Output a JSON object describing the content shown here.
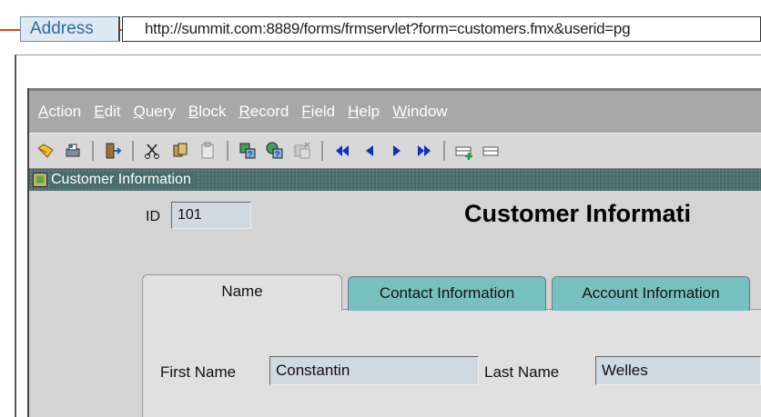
{
  "address_bar": {
    "label": "Address",
    "url": "http://summit.com:8889/forms/frmservlet?form=customers.fmx&userid=pg"
  },
  "menu": [
    {
      "label": "Action"
    },
    {
      "label": "Edit"
    },
    {
      "label": "Query"
    },
    {
      "label": "Block"
    },
    {
      "label": "Record"
    },
    {
      "label": "Field"
    },
    {
      "label": "Help"
    },
    {
      "label": "Window"
    }
  ],
  "toolbar": {
    "icons": [
      "save-icon",
      "print-icon",
      "exit-icon",
      "cut-icon",
      "copy-icon",
      "paste-icon",
      "enter-query-icon",
      "execute-query-icon",
      "cancel-query-icon",
      "previous-block-icon",
      "previous-record-icon",
      "next-record-icon",
      "next-block-icon",
      "insert-record-icon",
      "delete-record-icon"
    ]
  },
  "window": {
    "title": "Customer Information"
  },
  "form": {
    "id_label": "ID",
    "id_value": "101",
    "heading": "Customer Informati",
    "tabs": [
      {
        "label": "Name",
        "active": true
      },
      {
        "label": "Contact Information",
        "active": false
      },
      {
        "label": "Account Information",
        "active": false
      }
    ],
    "first_name_label": "First Name",
    "first_name_value": "Constantin",
    "last_name_label": "Last Name",
    "last_name_value": "Welles"
  },
  "colors": {
    "menubar": "#a8a8a8",
    "title_bar": "#4a6c6c",
    "tab_inactive": "#78c0c0",
    "arrow": "#d04a1a"
  }
}
